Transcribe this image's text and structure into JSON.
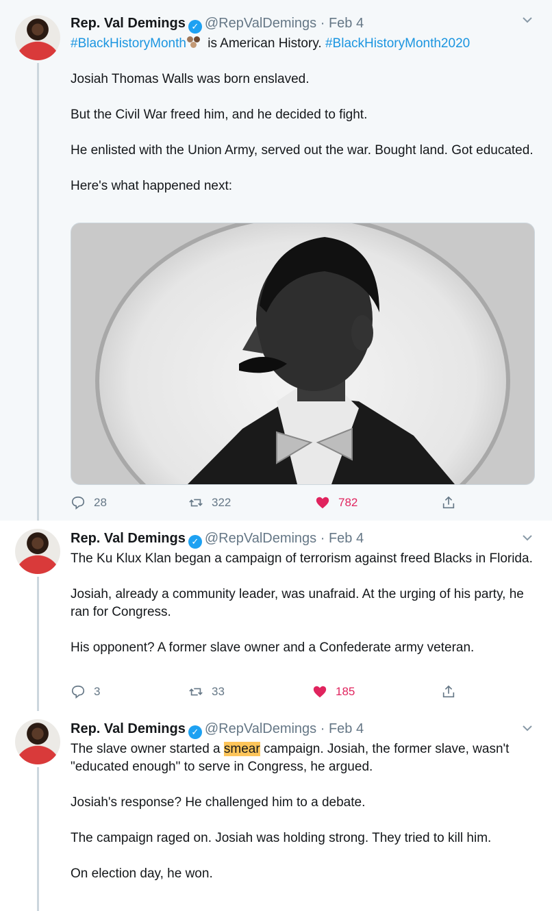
{
  "colors": {
    "link": "#1b95e0",
    "verified": "#1da1f2",
    "like": "#e0245e",
    "highlight": "#fec55a",
    "muted": "#657786"
  },
  "tweets": [
    {
      "author": "Rep. Val Demings",
      "handle": "@RepValDemings",
      "date": "· Feb 4",
      "hashtag1": "#BlackHistoryMonth",
      "headline_mid": " is American History. ",
      "hashtag2": "#BlackHistoryMonth2020",
      "paragraphs": [
        "Josiah Thomas Walls was born enslaved.",
        "But the Civil War freed him, and he decided to fight.",
        "He enlisted with the Union Army, served out the war. Bought land. Got educated.",
        "Here's what happened next:"
      ],
      "replies": "28",
      "retweets": "322",
      "likes": "782"
    },
    {
      "author": "Rep. Val Demings",
      "handle": "@RepValDemings",
      "date": "· Feb 4",
      "paragraphs": [
        "The Ku Klux Klan began a campaign of terrorism against freed Blacks in Florida.",
        "Josiah, already a community leader, was unafraid. At the urging of his party, he ran for Congress.",
        "His opponent? A former slave owner and a Confederate army veteran."
      ],
      "replies": "3",
      "retweets": "33",
      "likes": "185"
    },
    {
      "author": "Rep. Val Demings",
      "handle": "@RepValDemings",
      "date": "· Feb 4",
      "p1_before": "The slave owner started a ",
      "p1_highlight": "smear",
      "p1_after": " campaign. Josiah, the former slave, wasn't \"educated enough\" to serve in Congress, he argued.",
      "paragraphs": [
        "Josiah's response? He challenged him to a debate.",
        "The campaign raged on. Josiah was holding strong. They tried to kill him.",
        "On election day, he won."
      ]
    }
  ],
  "icons": {
    "verified": "verified-badge-icon",
    "reply": "reply-icon",
    "retweet": "retweet-icon",
    "like": "heart-icon",
    "share": "share-icon",
    "more": "chevron-down-icon"
  }
}
